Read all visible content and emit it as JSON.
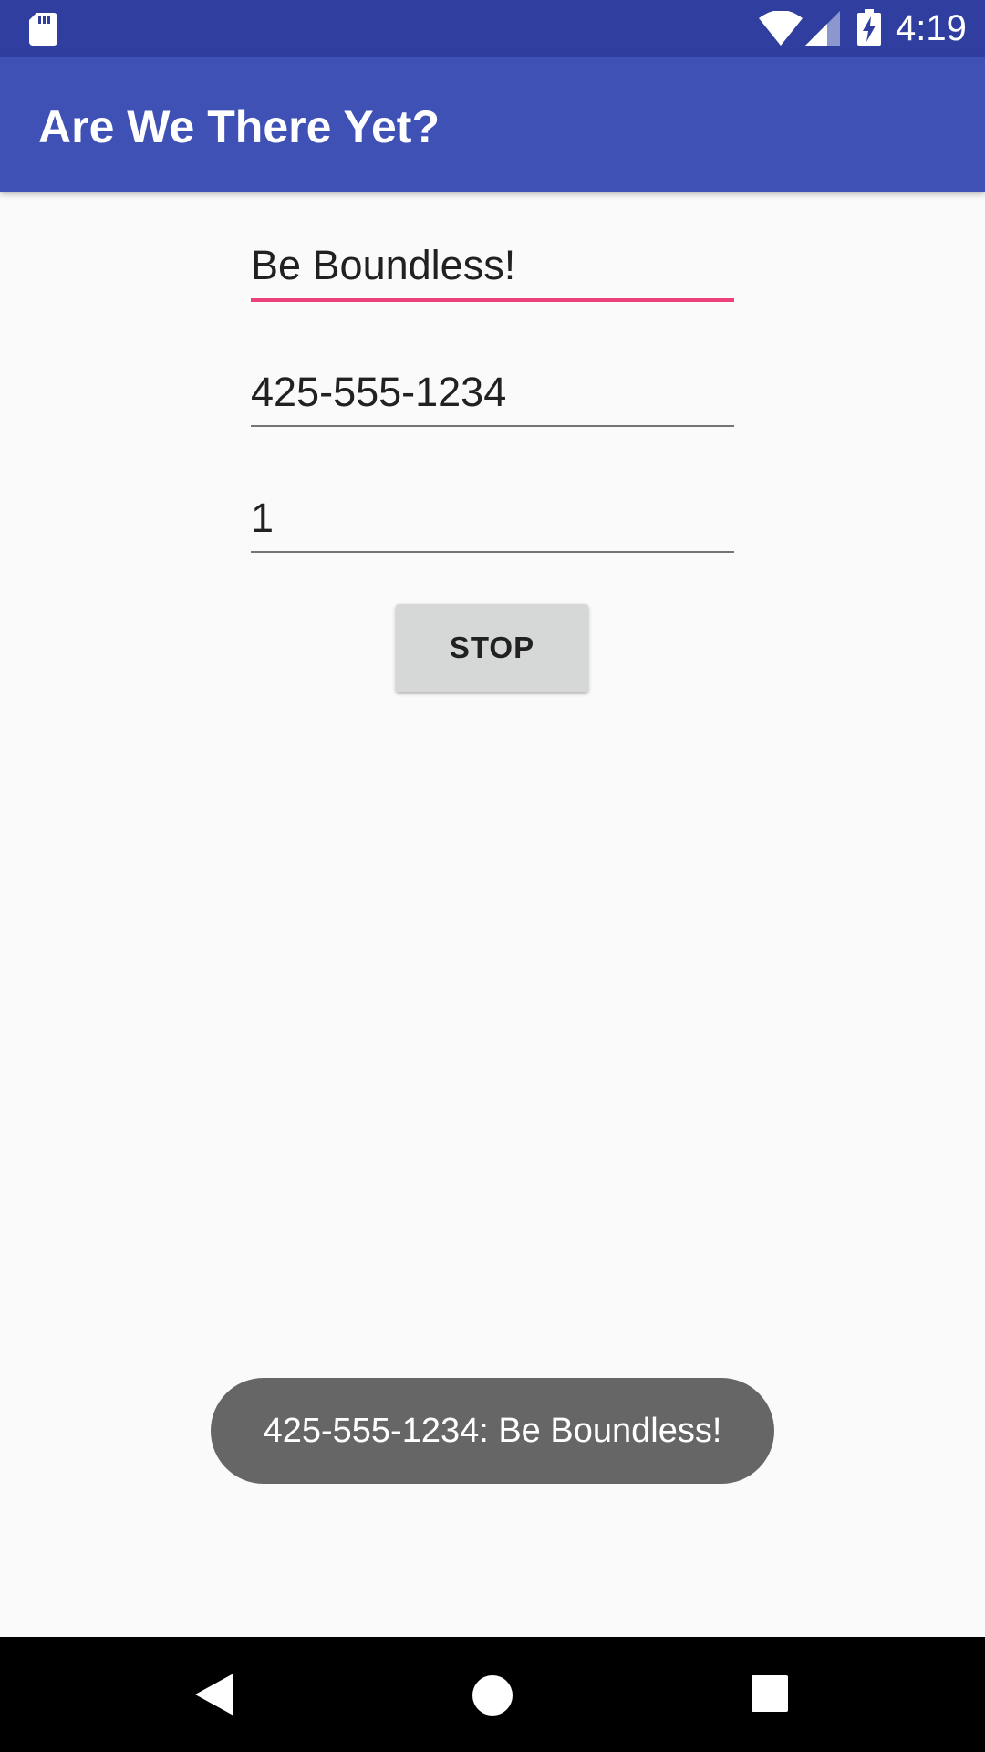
{
  "status_bar": {
    "time": "4:19",
    "icons": [
      "sd-card-icon",
      "wifi-icon",
      "cell-signal-icon",
      "battery-charging-icon"
    ],
    "color": "#303f9f"
  },
  "app_bar": {
    "title": "Are We There Yet?",
    "color": "#3f51b5"
  },
  "form": {
    "message_value": "Be Boundless!",
    "phone_value": "425-555-1234",
    "interval_value": "1",
    "focus_color": "#ec407a",
    "stop_label": "STOP"
  },
  "toast": {
    "text": "425-555-1234: Be Boundless!"
  },
  "nav_bar": {
    "icons": [
      "back-icon",
      "home-icon",
      "recents-icon"
    ]
  }
}
